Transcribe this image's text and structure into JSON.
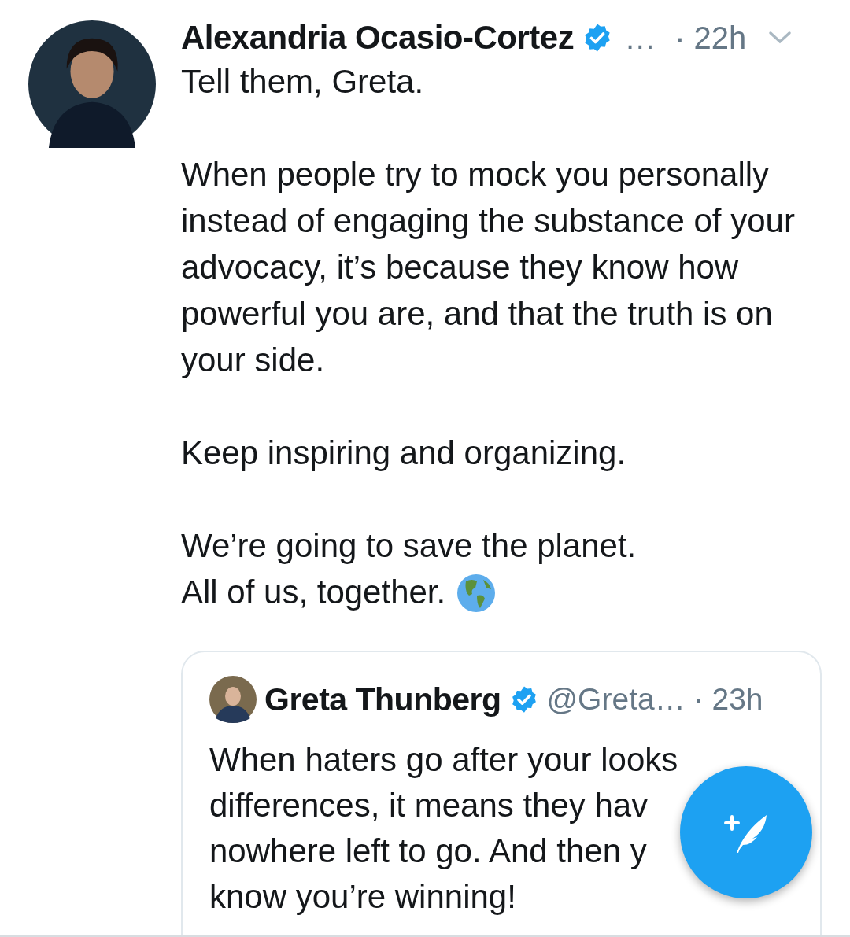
{
  "tweet": {
    "author": "Alexandria Ocasio-Cortez",
    "verified": true,
    "handle": "…",
    "time": "· 22h",
    "paragraphs": [
      "Tell them, Greta.",
      "When people try to mock you personally instead of engaging the substance of your advocacy, it’s because they know how powerful you are, and that the truth is on your side.",
      "Keep inspiring and organizing.",
      "We’re going to save the planet.\nAll of us, together."
    ],
    "quote": {
      "author": "Greta Thunberg",
      "verified": true,
      "handle": "@Greta…",
      "time": "· 23h",
      "lines": [
        "When haters go after your looks",
        "differences, it means they hav",
        "nowhere left to go. And then y",
        "know you’re winning!"
      ]
    }
  }
}
